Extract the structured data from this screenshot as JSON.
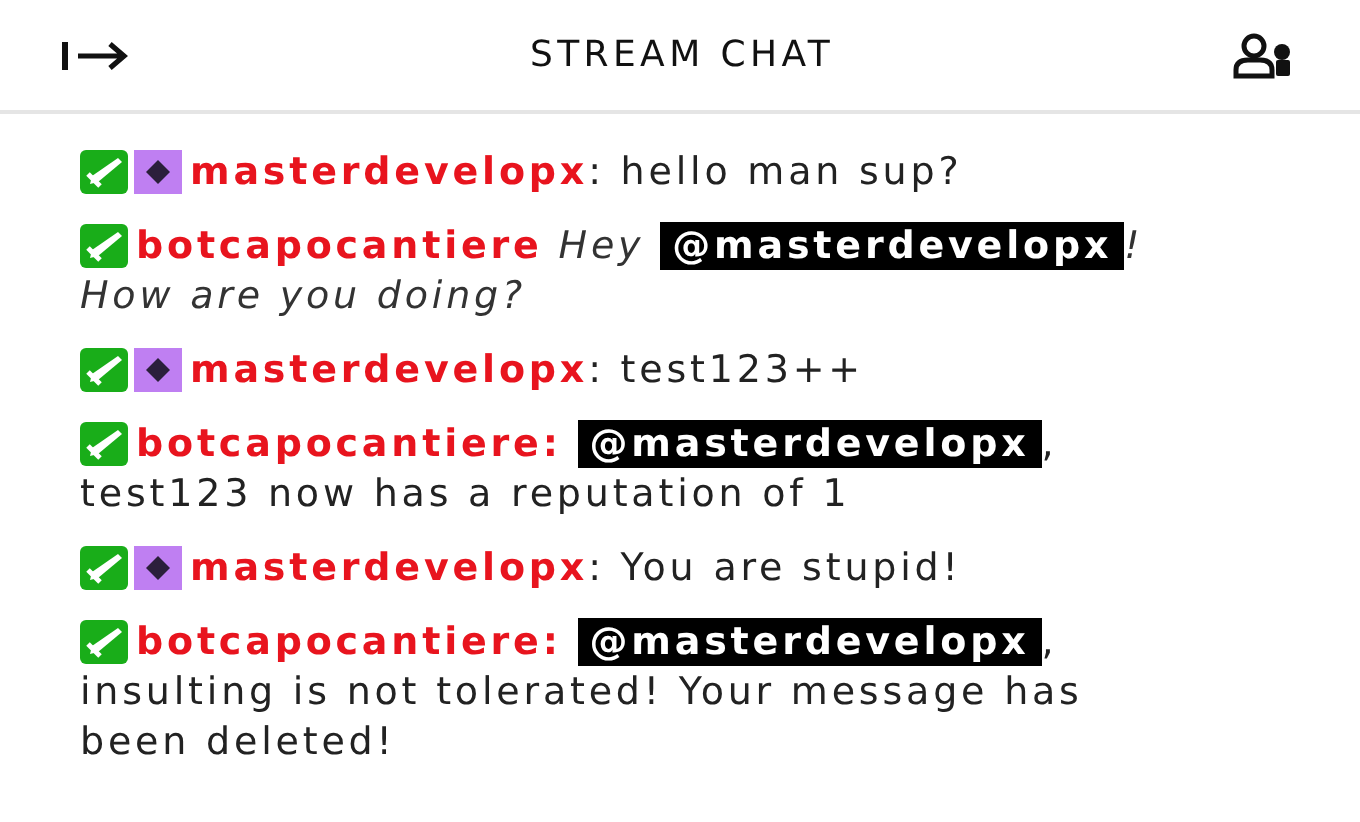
{
  "header": {
    "title": "STREAM CHAT"
  },
  "messages": [
    {
      "badges": [
        {
          "kind": "sword"
        },
        {
          "kind": "diamond"
        }
      ],
      "user": "masterdevelopx",
      "italic": false,
      "parts": [
        {
          "kind": "text",
          "text": ": hello man sup?"
        }
      ]
    },
    {
      "badges": [
        {
          "kind": "sword"
        }
      ],
      "user": "botcapocantiere",
      "italic": true,
      "parts": [
        {
          "kind": "text",
          "text": "Hey"
        },
        {
          "kind": "mention",
          "text": "@masterdevelopx"
        },
        {
          "kind": "text",
          "text": "!"
        },
        {
          "kind": "break"
        },
        {
          "kind": "text",
          "text": "How are you doing?"
        }
      ]
    },
    {
      "badges": [
        {
          "kind": "sword"
        },
        {
          "kind": "diamond"
        }
      ],
      "user": "masterdevelopx",
      "italic": false,
      "parts": [
        {
          "kind": "text",
          "text": ": test123++"
        }
      ]
    },
    {
      "badges": [
        {
          "kind": "sword"
        }
      ],
      "user": "botcapocantiere:",
      "italic": false,
      "parts": [
        {
          "kind": "mention",
          "text": "@masterdevelopx"
        },
        {
          "kind": "text",
          "text": ","
        },
        {
          "kind": "break"
        },
        {
          "kind": "text",
          "text": "test123 now has a reputation of 1"
        }
      ]
    },
    {
      "badges": [
        {
          "kind": "sword"
        },
        {
          "kind": "diamond"
        }
      ],
      "user": "masterdevelopx",
      "italic": false,
      "parts": [
        {
          "kind": "text",
          "text": ": You are stupid!"
        }
      ]
    },
    {
      "badges": [
        {
          "kind": "sword"
        }
      ],
      "user": "botcapocantiere:",
      "italic": false,
      "parts": [
        {
          "kind": "mention",
          "text": "@masterdevelopx"
        },
        {
          "kind": "text",
          "text": ","
        },
        {
          "kind": "break"
        },
        {
          "kind": "text",
          "text": "insulting is not tolerated! Your message has been deleted!"
        }
      ]
    }
  ]
}
